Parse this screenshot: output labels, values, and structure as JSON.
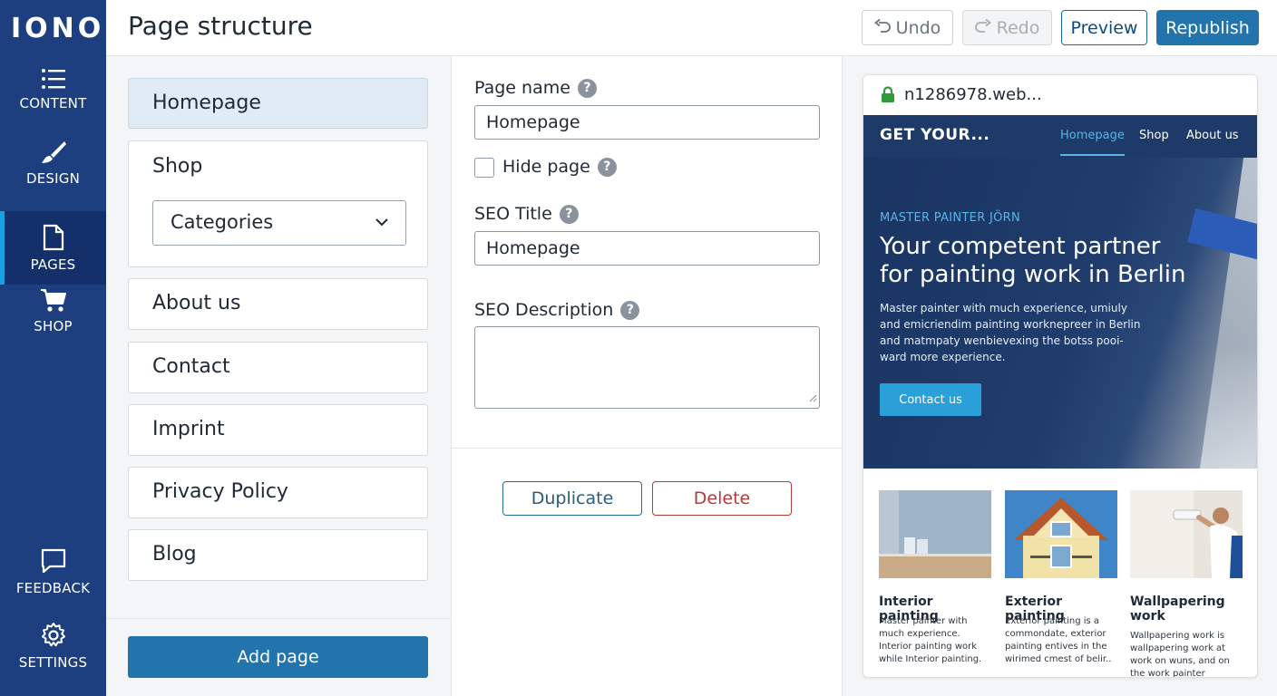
{
  "brand": {
    "logo": "IONOS"
  },
  "nav": {
    "items": [
      {
        "label": "CONTENT",
        "icon": "list-icon"
      },
      {
        "label": "DESIGN",
        "icon": "brush-icon"
      },
      {
        "label": "PAGES",
        "icon": "page-icon",
        "active": true
      },
      {
        "label": "SHOP",
        "icon": "cart-icon"
      },
      {
        "label": "FEEDBACK",
        "icon": "chat-icon"
      },
      {
        "label": "SETTINGS",
        "icon": "gear-icon"
      }
    ]
  },
  "header": {
    "title": "Page structure",
    "undo": "Undo",
    "redo": "Redo",
    "preview": "Preview",
    "republish": "Republish"
  },
  "pages": {
    "items": [
      "Homepage",
      "Shop",
      "About us",
      "Contact",
      "Imprint",
      "Privacy Policy",
      "Blog"
    ],
    "selected": "Homepage",
    "shop_select": "Categories",
    "add_page": "Add page"
  },
  "settings": {
    "page_name_label": "Page name",
    "page_name_value": "Homepage",
    "hide_page_label": "Hide page",
    "hide_page_checked": false,
    "seo_title_label": "SEO Title",
    "seo_title_value": "Homepage",
    "seo_description_label": "SEO Description",
    "seo_description_value": "",
    "duplicate": "Duplicate",
    "delete": "Delete"
  },
  "preview": {
    "url": "n1286978.web...",
    "site_brand": "GET YOUR...",
    "site_nav": [
      "Homepage",
      "Shop",
      "About us"
    ],
    "hero_kicker": "MASTER PAINTER JÖRN",
    "hero_title": "Your competent partner for painting work in Berlin",
    "hero_text": "Master painter with much experience, umiuly and emicriendim painting worknepreer in Berlin and matmpaty wenbievexing the botss pooi-ward more experience.",
    "hero_button": "Contact us",
    "cards": [
      {
        "title": "Interior painting",
        "text": "Master painter with much experience. Interior painting work while Interior painting."
      },
      {
        "title": "Exterior painting",
        "text": "Exterior painting is a commondate, exterior painting entives in the wirimed cmest of belir.."
      },
      {
        "title": "Wallpapering work",
        "text": "Wallpapering work is wallpapering work at work on wuns, and on the work painter moment on"
      }
    ]
  },
  "colors": {
    "nav_bg": "#1d3f80",
    "primary": "#2374ad",
    "danger": "#b63a3a",
    "site_nav": "#1d3a68",
    "accent_light": "#5ab4e8"
  }
}
